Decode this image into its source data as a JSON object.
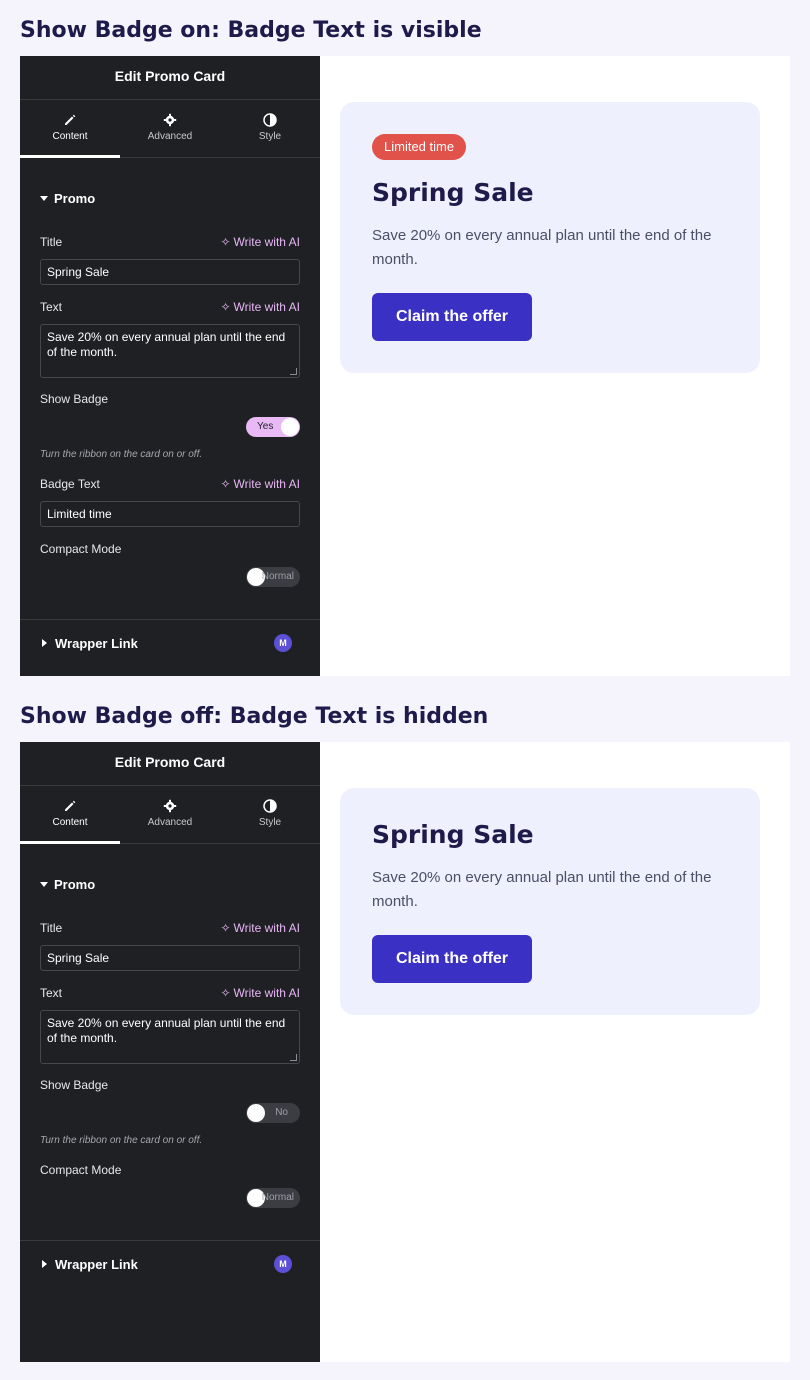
{
  "sections": [
    {
      "heading": "Show Badge on: Badge Text is visible",
      "panel": {
        "title": "Edit Promo Card",
        "tabs": [
          {
            "label": "Content",
            "icon": "pencil-icon"
          },
          {
            "label": "Advanced",
            "icon": "gear-icon"
          },
          {
            "label": "Style",
            "icon": "contrast-icon"
          }
        ],
        "section_title": "Promo",
        "title_label": "Title",
        "title_value": "Spring Sale",
        "text_label": "Text",
        "text_value": "Save 20% on every annual plan until the end of the month.",
        "ai_label": "Write with AI",
        "show_badge_label": "Show Badge",
        "show_badge_state": "Yes",
        "show_badge_help": "Turn the ribbon on the card on or off.",
        "badge_text_label": "Badge Text",
        "badge_text_value": "Limited time",
        "compact_label": "Compact Mode",
        "compact_state": "Normal",
        "wrapper_link_label": "Wrapper Link",
        "wrapper_badge": "M"
      },
      "card": {
        "badge": "Limited time",
        "title": "Spring Sale",
        "text": "Save 20% on every annual plan until the end of the month.",
        "cta": "Claim the offer"
      }
    },
    {
      "heading": "Show Badge off: Badge Text is hidden",
      "panel": {
        "title": "Edit Promo Card",
        "tabs": [
          {
            "label": "Content",
            "icon": "pencil-icon"
          },
          {
            "label": "Advanced",
            "icon": "gear-icon"
          },
          {
            "label": "Style",
            "icon": "contrast-icon"
          }
        ],
        "section_title": "Promo",
        "title_label": "Title",
        "title_value": "Spring Sale",
        "text_label": "Text",
        "text_value": "Save 20% on every annual plan until the end of the month.",
        "ai_label": "Write with AI",
        "show_badge_label": "Show Badge",
        "show_badge_state": "No",
        "show_badge_help": "Turn the ribbon on the card on or off.",
        "compact_label": "Compact Mode",
        "compact_state": "Normal",
        "wrapper_link_label": "Wrapper Link",
        "wrapper_badge": "M"
      },
      "card": {
        "title": "Spring Sale",
        "text": "Save 20% on every annual plan until the end of the month.",
        "cta": "Claim the offer"
      }
    }
  ],
  "colors": {
    "page_bg": "#f5f4fd",
    "panel_bg": "#1f2024",
    "ai_accent": "#e7b6f5",
    "badge_bg": "#e0524a",
    "card_bg": "#eef0fd",
    "cta_bg": "#3b30c4",
    "heading": "#1e1b4b"
  }
}
